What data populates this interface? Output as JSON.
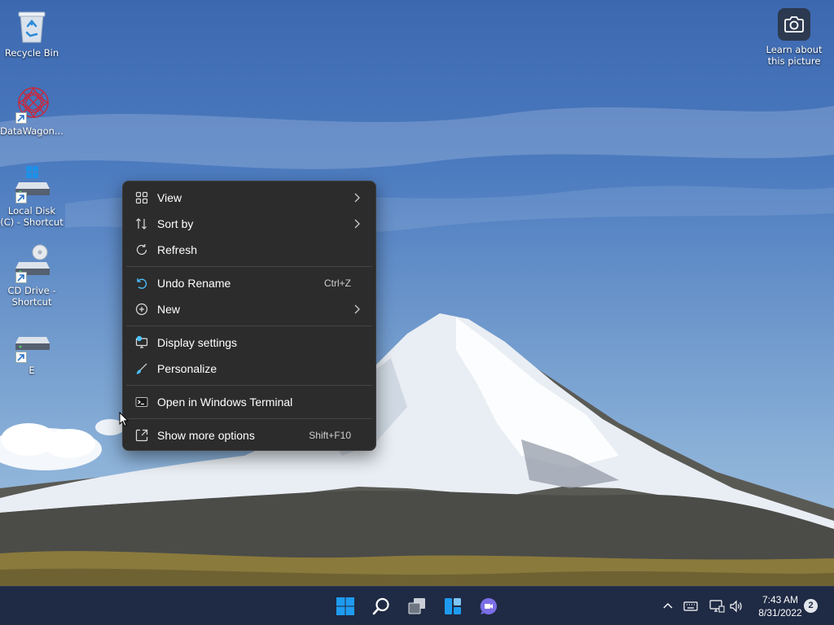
{
  "desktop": {
    "icons": [
      {
        "label": "Recycle Bin"
      },
      {
        "label": "DataWagon..."
      },
      {
        "label": "Local Disk (C) - Shortcut"
      },
      {
        "label": "CD Drive - Shortcut"
      },
      {
        "label": "E"
      }
    ],
    "spotlight": {
      "label": "Learn about this picture"
    }
  },
  "context_menu": {
    "items": [
      {
        "label": "View",
        "icon": "grid-icon",
        "has_submenu": true
      },
      {
        "label": "Sort by",
        "icon": "sort-icon",
        "has_submenu": true
      },
      {
        "label": "Refresh",
        "icon": "refresh-icon"
      },
      {
        "label": "Undo Rename",
        "icon": "undo-icon",
        "shortcut": "Ctrl+Z"
      },
      {
        "label": "New",
        "icon": "plus-circle-icon",
        "has_submenu": true
      },
      {
        "label": "Display settings",
        "icon": "display-icon"
      },
      {
        "label": "Personalize",
        "icon": "brush-icon"
      },
      {
        "label": "Open in Windows Terminal",
        "icon": "terminal-icon"
      },
      {
        "label": "Show more options",
        "icon": "expand-icon",
        "shortcut": "Shift+F10"
      }
    ]
  },
  "taskbar": {
    "apps": [
      "start",
      "search",
      "task-view",
      "widgets",
      "teams-chat"
    ],
    "clock": {
      "time": "7:43 AM",
      "date": "8/31/2022"
    },
    "notification_count": "2"
  },
  "colors": {
    "menu_bg": "#2c2c2c",
    "taskbar_bg": "#1f2a44",
    "accent": "#4cc2ff"
  }
}
